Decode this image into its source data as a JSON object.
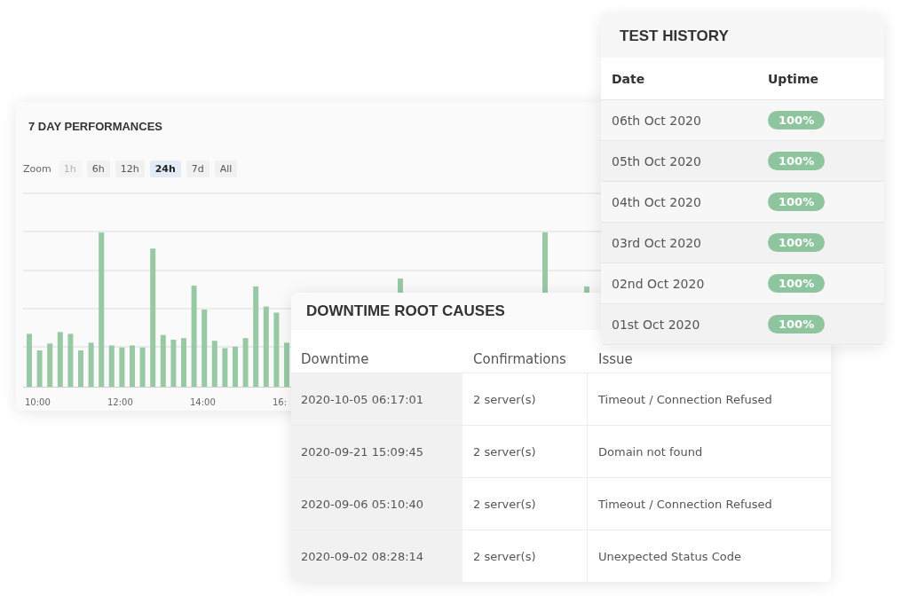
{
  "performance": {
    "title": "7 DAY PERFORMANCES",
    "zoom_label": "Zoom",
    "zoom_options": [
      {
        "label": "1h",
        "selected": false,
        "disabled": true
      },
      {
        "label": "6h",
        "selected": false,
        "disabled": false
      },
      {
        "label": "12h",
        "selected": false,
        "disabled": false
      },
      {
        "label": "24h",
        "selected": true,
        "disabled": false
      },
      {
        "label": "7d",
        "selected": false,
        "disabled": false
      },
      {
        "label": "All",
        "selected": false,
        "disabled": false
      }
    ],
    "x_labels": [
      "10:00",
      "12:00",
      "14:00",
      "16:"
    ]
  },
  "test_history": {
    "title": "TEST HISTORY",
    "columns": [
      "Date",
      "Uptime"
    ],
    "rows": [
      {
        "date": "06th Oct 2020",
        "uptime": "100%"
      },
      {
        "date": "05th Oct 2020",
        "uptime": "100%"
      },
      {
        "date": "04th Oct 2020",
        "uptime": "100%"
      },
      {
        "date": "03rd Oct 2020",
        "uptime": "100%"
      },
      {
        "date": "02nd Oct 2020",
        "uptime": "100%"
      },
      {
        "date": "01st Oct 2020",
        "uptime": "100%"
      }
    ]
  },
  "downtime": {
    "title": "DOWNTIME ROOT CAUSES",
    "columns": [
      "Downtime",
      "Confirmations",
      "Issue"
    ],
    "rows": [
      {
        "downtime": "2020-10-05 06:17:01",
        "confirmations": "2 server(s)",
        "issue": "Timeout / Connection Refused"
      },
      {
        "downtime": "2020-09-21 15:09:45",
        "confirmations": "2 server(s)",
        "issue": "Domain not found"
      },
      {
        "downtime": "2020-09-06 05:10:40",
        "confirmations": "2 server(s)",
        "issue": "Timeout / Connection Refused"
      },
      {
        "downtime": "2020-09-02 08:28:14",
        "confirmations": "2 server(s)",
        "issue": "Unexpected Status Code"
      }
    ]
  }
}
